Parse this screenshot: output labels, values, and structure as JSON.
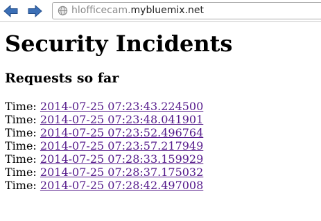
{
  "browser": {
    "url_subdomain": "hlofficecam.",
    "url_domain": "mybluemix.net"
  },
  "page": {
    "title": "Security Incidents",
    "subtitle": "Requests so far",
    "time_label": "Time:",
    "requests": [
      "2014-07-25 07:23:43.224500",
      "2014-07-25 07:23:48.041901",
      "2014-07-25 07:23:52.496764",
      "2014-07-25 07:23:57.217949",
      "2014-07-25 07:28:33.159929",
      "2014-07-25 07:28:37.175032",
      "2014-07-25 07:28:42.497008"
    ]
  },
  "icons": {
    "back": "arrow-left-icon",
    "forward": "arrow-right-icon",
    "site": "globe-icon"
  },
  "colors": {
    "nav_arrow": "#3b6fb6",
    "visited_link": "#551a8b"
  }
}
